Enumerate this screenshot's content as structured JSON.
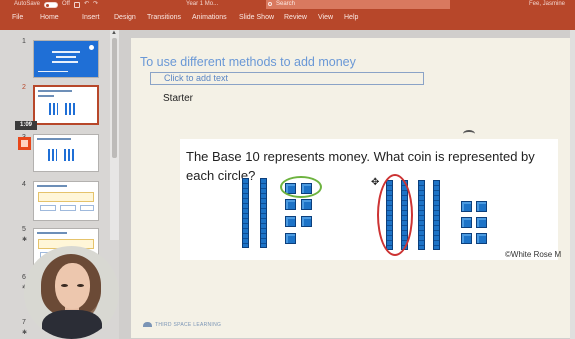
{
  "titlebar": {
    "autosave_label": "AutoSave",
    "autosave_state": "Off",
    "document_title": "Year 1 Mo...",
    "search_placeholder": "Search",
    "user": "Fee, Jasmine"
  },
  "ribbon": {
    "tabs": [
      "File",
      "Home",
      "Insert",
      "Design",
      "Transitions",
      "Animations",
      "Slide Show",
      "Review",
      "View",
      "Help"
    ]
  },
  "thumbnails": {
    "numbers": [
      "1",
      "2",
      "3",
      "4",
      "5",
      "6",
      "7"
    ],
    "selected_index": 2,
    "slide1_text": "Three Space Learning"
  },
  "recording": {
    "timer": "1:09"
  },
  "slide": {
    "title": "To use different methods to add money",
    "placeholder": "Click to add text",
    "subtitle": "Starter",
    "question": "The Base 10 represents money. What coin is represented by each circle?",
    "copyright": "©White Rose M",
    "footer_brand": "THIRD SPACE LEARNING"
  },
  "colors": {
    "ribbon": "#b7472a",
    "title_blue": "#6a98d6",
    "base10_blue": "#1d73c7",
    "circle_green": "#6db33f",
    "circle_red": "#cc3333"
  }
}
